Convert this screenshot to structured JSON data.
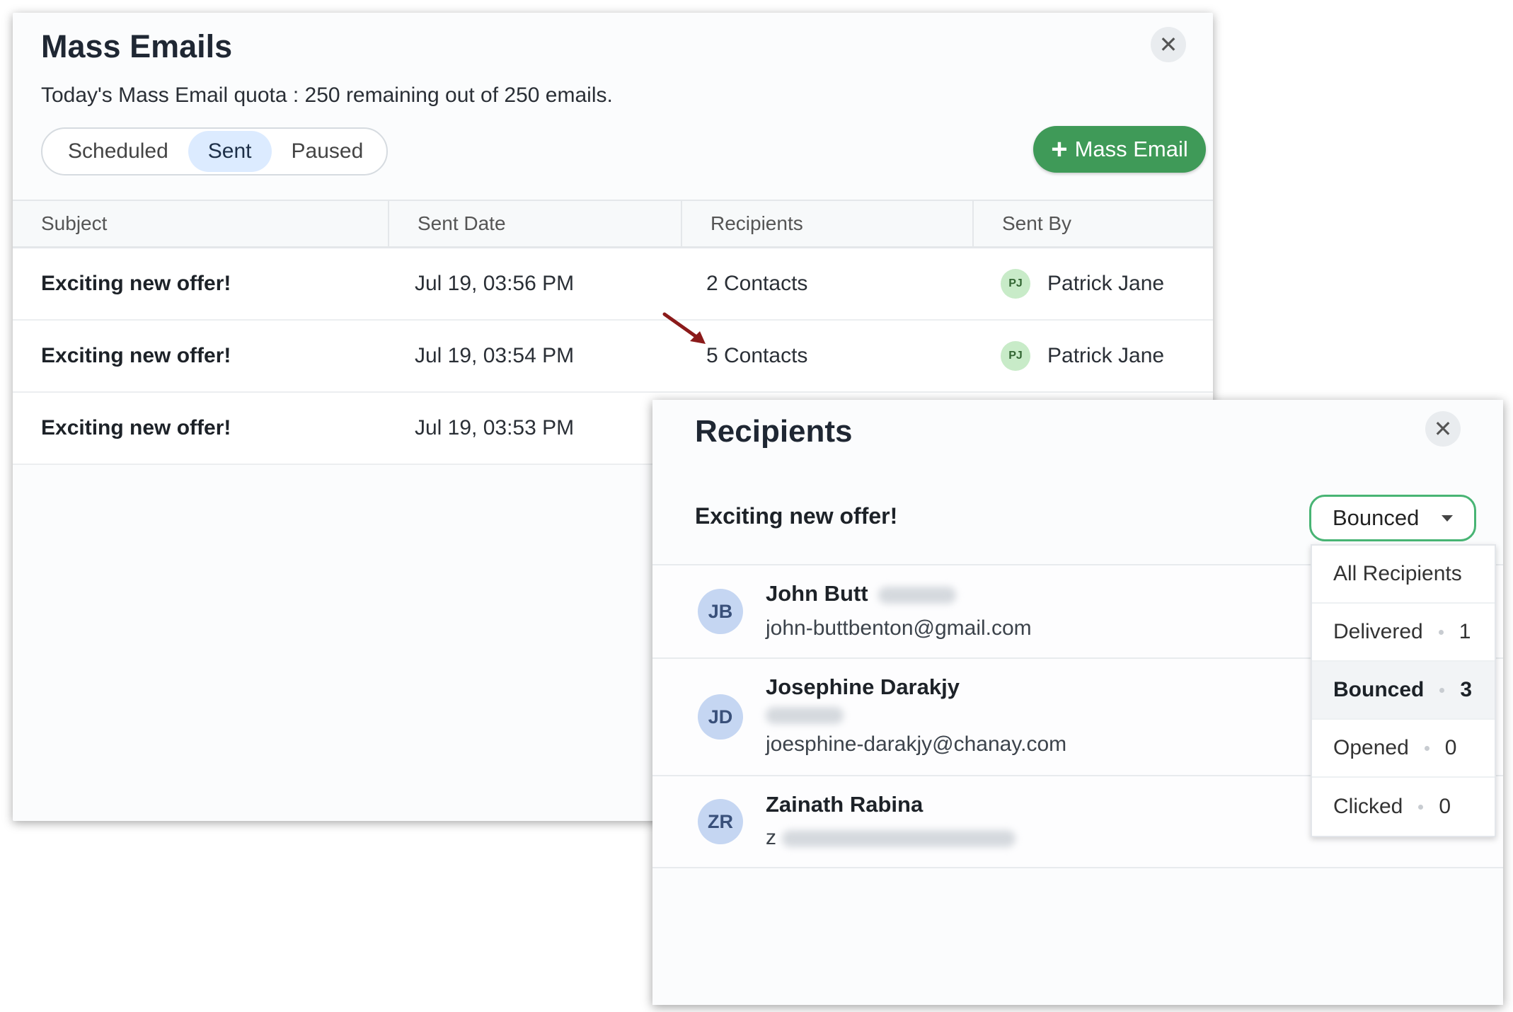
{
  "mass_emails": {
    "title": "Mass Emails",
    "quota": "Today's Mass Email quota : 250 remaining out of 250 emails.",
    "tabs": [
      {
        "label": "Scheduled",
        "active": false
      },
      {
        "label": "Sent",
        "active": true
      },
      {
        "label": "Paused",
        "active": false
      }
    ],
    "add_button_label": "Mass Email",
    "columns": [
      "Subject",
      "Sent Date",
      "Recipients",
      "Sent By"
    ],
    "rows": [
      {
        "subject": "Exciting new offer!",
        "sent_date": "Jul 19, 03:56 PM",
        "recipients": "2 Contacts",
        "sender_initials": "PJ",
        "sender": "Patrick Jane"
      },
      {
        "subject": "Exciting new offer!",
        "sent_date": "Jul 19, 03:54 PM",
        "recipients": "5 Contacts",
        "sender_initials": "PJ",
        "sender": "Patrick Jane"
      },
      {
        "subject": "Exciting new offer!",
        "sent_date": "Jul 19, 03:53 PM"
      }
    ],
    "accent_color": "#3f9a58"
  },
  "recipients_panel": {
    "title": "Recipients",
    "subject": "Exciting new offer!",
    "filter_selected": "Bounced",
    "recipients": [
      {
        "initials": "JB",
        "name": "John Butt",
        "email": "john-buttbenton@gmail.com"
      },
      {
        "initials": "JD",
        "name": "Josephine Darakjy",
        "email": "joesphine-darakjy@chanay.com"
      },
      {
        "initials": "ZR",
        "name": "Zainath Rabina",
        "email_prefix": "z"
      }
    ],
    "filter_options": [
      {
        "label": "All Recipients"
      },
      {
        "label": "Delivered",
        "count": "1"
      },
      {
        "label": "Bounced",
        "count": "3",
        "selected": true
      },
      {
        "label": "Opened",
        "count": "0"
      },
      {
        "label": "Clicked",
        "count": "0"
      }
    ],
    "focus_color": "#48b474"
  }
}
